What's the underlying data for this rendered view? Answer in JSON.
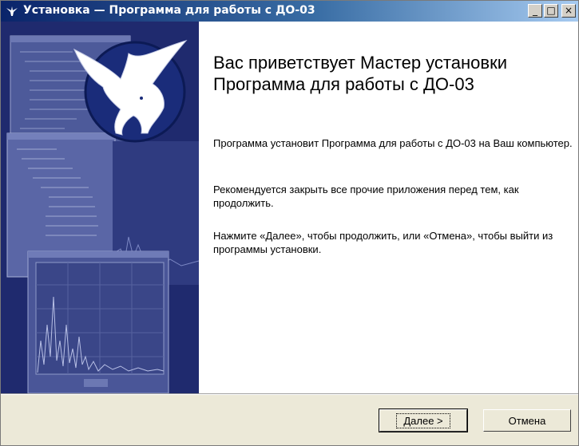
{
  "window": {
    "title": "Установка — Программа для работы с ДО-03",
    "controls": {
      "minimize": "_",
      "maximize": "□",
      "close": "×"
    }
  },
  "content": {
    "heading": "Вас приветствует Мастер установки Программа для работы с ДО-03",
    "paragraphs": [
      "Программа установит Программа для работы с ДО-03 на Ваш компьютер.",
      "Рекомендуется закрыть все прочие приложения перед тем, как продолжить.",
      "Нажмите «Далее», чтобы продолжить, или «Отмена», чтобы выйти из программы установки."
    ]
  },
  "buttons": {
    "next": "Далее >",
    "cancel": "Отмена"
  },
  "colors": {
    "titlebar_start": "#0a246a",
    "titlebar_end": "#a6caf0",
    "sidebar": "#1f2a6e"
  },
  "icons": {
    "title": "bird-icon",
    "logo": "bird-logo-icon"
  }
}
